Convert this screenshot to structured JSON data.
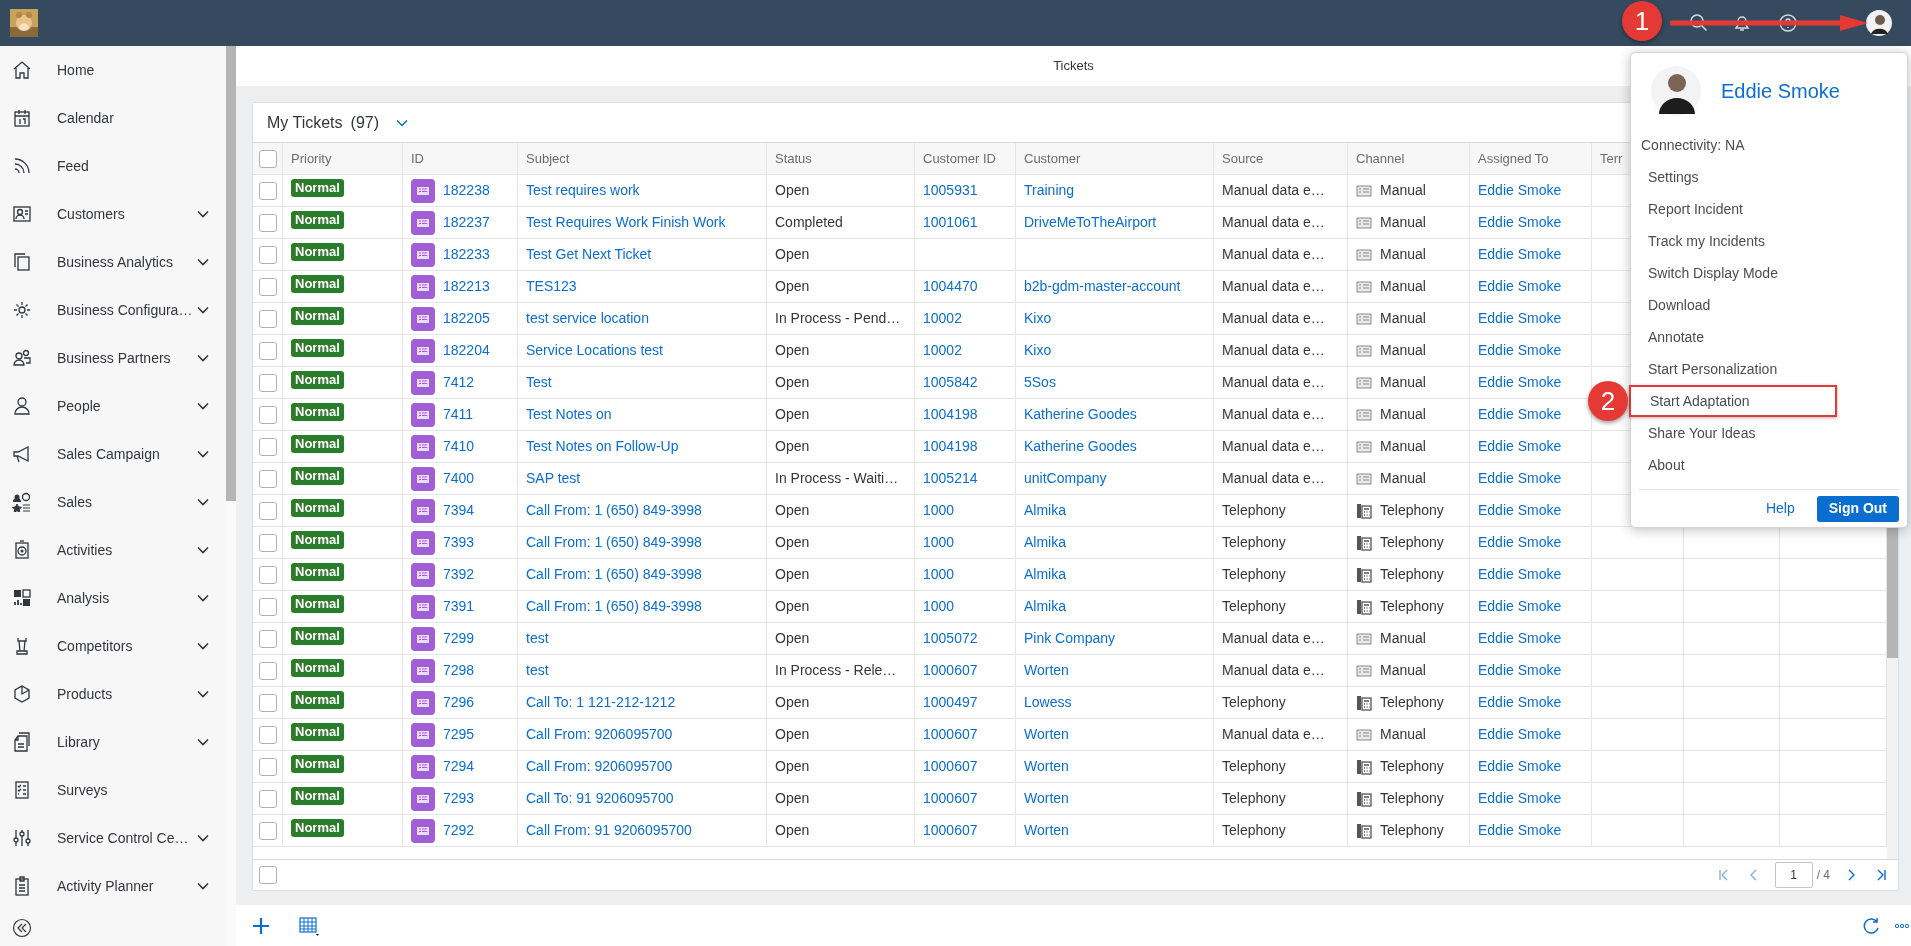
{
  "sidebar": {
    "items": [
      {
        "label": "Home",
        "expandable": false
      },
      {
        "label": "Calendar",
        "expandable": false
      },
      {
        "label": "Feed",
        "expandable": false
      },
      {
        "label": "Customers",
        "expandable": true
      },
      {
        "label": "Business Analytics",
        "expandable": true
      },
      {
        "label": "Business Configura…",
        "expandable": true
      },
      {
        "label": "Business Partners",
        "expandable": true
      },
      {
        "label": "People",
        "expandable": true
      },
      {
        "label": "Sales Campaign",
        "expandable": true
      },
      {
        "label": "Sales",
        "expandable": true
      },
      {
        "label": "Activities",
        "expandable": true
      },
      {
        "label": "Analysis",
        "expandable": true
      },
      {
        "label": "Competitors",
        "expandable": true
      },
      {
        "label": "Products",
        "expandable": true
      },
      {
        "label": "Library",
        "expandable": true
      },
      {
        "label": "Surveys",
        "expandable": false
      },
      {
        "label": "Service Control Ce…",
        "expandable": true
      },
      {
        "label": "Activity Planner",
        "expandable": true
      }
    ]
  },
  "page_title": "Tickets",
  "table": {
    "title": "My Tickets",
    "count": "(97)",
    "header_checked": false,
    "footer_checked": false,
    "columns": [
      "Priority",
      "ID",
      "Subject",
      "Status",
      "Customer ID",
      "Customer",
      "Source",
      "Channel",
      "Assigned To",
      "Terr"
    ],
    "rows": [
      {
        "selected": false,
        "priority": "Normal",
        "id": "182238",
        "subject": "Test requires work",
        "status": "Open",
        "customer_id": "1005931",
        "customer": "Training",
        "source": "Manual data e…",
        "channel": {
          "kind": "manual",
          "label": "Manual"
        },
        "assigned_to": "Eddie Smoke"
      },
      {
        "selected": false,
        "priority": "Normal",
        "id": "182237",
        "subject": "Test Requires Work Finish Work",
        "status": "Completed",
        "customer_id": "1001061",
        "customer": "DriveMeToTheAirport",
        "source": "Manual data e…",
        "channel": {
          "kind": "manual",
          "label": "Manual"
        },
        "assigned_to": "Eddie Smoke"
      },
      {
        "selected": false,
        "priority": "Normal",
        "id": "182233",
        "subject": "Test Get Next Ticket",
        "status": "Open",
        "source": "Manual data e…",
        "channel": {
          "kind": "manual",
          "label": "Manual"
        },
        "assigned_to": "Eddie Smoke"
      },
      {
        "selected": false,
        "priority": "Normal",
        "id": "182213",
        "subject": "TES123",
        "status": "Open",
        "customer_id": "1004470",
        "customer": "b2b-gdm-master-account",
        "source": "Manual data e…",
        "channel": {
          "kind": "manual",
          "label": "Manual"
        },
        "assigned_to": "Eddie Smoke"
      },
      {
        "selected": false,
        "priority": "Normal",
        "id": "182205",
        "subject": "test service location",
        "status": "In Process - Pend…",
        "customer_id": "10002",
        "customer": "Kixo",
        "source": "Manual data e…",
        "channel": {
          "kind": "manual",
          "label": "Manual"
        },
        "assigned_to": "Eddie Smoke"
      },
      {
        "selected": false,
        "priority": "Normal",
        "id": "182204",
        "subject": "Service Locations test",
        "status": "Open",
        "customer_id": "10002",
        "customer": "Kixo",
        "source": "Manual data e…",
        "channel": {
          "kind": "manual",
          "label": "Manual"
        },
        "assigned_to": "Eddie Smoke"
      },
      {
        "selected": false,
        "priority": "Normal",
        "id": "7412",
        "subject": "Test",
        "status": "Open",
        "customer_id": "1005842",
        "customer": "5Sos",
        "source": "Manual data e…",
        "channel": {
          "kind": "manual",
          "label": "Manual"
        },
        "assigned_to": "Eddie Smoke"
      },
      {
        "selected": false,
        "priority": "Normal",
        "id": "7411",
        "subject": "Test Notes on",
        "status": "Open",
        "customer_id": "1004198",
        "customer": "Katherine Goodes",
        "source": "Manual data e…",
        "channel": {
          "kind": "manual",
          "label": "Manual"
        },
        "assigned_to": "Eddie Smoke"
      },
      {
        "selected": false,
        "priority": "Normal",
        "id": "7410",
        "subject": "Test Notes on Follow-Up",
        "status": "Open",
        "customer_id": "1004198",
        "customer": "Katherine Goodes",
        "source": "Manual data e…",
        "channel": {
          "kind": "manual",
          "label": "Manual"
        },
        "assigned_to": "Eddie Smoke"
      },
      {
        "selected": false,
        "priority": "Normal",
        "id": "7400",
        "subject": "SAP test",
        "status": "In Process - Waiti…",
        "customer_id": "1005214",
        "customer": "unitCompany",
        "source": "Manual data e…",
        "channel": {
          "kind": "manual",
          "label": "Manual"
        },
        "assigned_to": "Eddie Smoke"
      },
      {
        "selected": false,
        "priority": "Normal",
        "id": "7394",
        "subject": "Call From: 1 (650) 849-3998",
        "status": "Open",
        "customer_id": "1000",
        "customer": "Almika",
        "source": "Telephony",
        "channel": {
          "kind": "telephony",
          "label": "Telephony"
        },
        "assigned_to": "Eddie Smoke"
      },
      {
        "selected": false,
        "priority": "Normal",
        "id": "7393",
        "subject": "Call From: 1 (650) 849-3998",
        "status": "Open",
        "customer_id": "1000",
        "customer": "Almika",
        "source": "Telephony",
        "channel": {
          "kind": "telephony",
          "label": "Telephony"
        },
        "assigned_to": "Eddie Smoke"
      },
      {
        "selected": false,
        "priority": "Normal",
        "id": "7392",
        "subject": "Call From: 1 (650) 849-3998",
        "status": "Open",
        "customer_id": "1000",
        "customer": "Almika",
        "source": "Telephony",
        "channel": {
          "kind": "telephony",
          "label": "Telephony"
        },
        "assigned_to": "Eddie Smoke"
      },
      {
        "selected": false,
        "priority": "Normal",
        "id": "7391",
        "subject": "Call From: 1 (650) 849-3998",
        "status": "Open",
        "customer_id": "1000",
        "customer": "Almika",
        "source": "Telephony",
        "channel": {
          "kind": "telephony",
          "label": "Telephony"
        },
        "assigned_to": "Eddie Smoke"
      },
      {
        "selected": false,
        "priority": "Normal",
        "id": "7299",
        "subject": "test",
        "status": "Open",
        "customer_id": "1005072",
        "customer": "Pink Company",
        "source": "Manual data e…",
        "channel": {
          "kind": "manual",
          "label": "Manual"
        },
        "assigned_to": "Eddie Smoke"
      },
      {
        "selected": false,
        "priority": "Normal",
        "id": "7298",
        "subject": "test",
        "status": "In Process - Rele…",
        "customer_id": "1000607",
        "customer": "Worten",
        "source": "Manual data e…",
        "channel": {
          "kind": "manual",
          "label": "Manual"
        },
        "assigned_to": "Eddie Smoke"
      },
      {
        "selected": false,
        "priority": "Normal",
        "id": "7296",
        "subject": "Call To: 1 121-212-1212",
        "status": "Open",
        "customer_id": "1000497",
        "customer": "Lowess",
        "source": "Telephony",
        "channel": {
          "kind": "telephony",
          "label": "Telephony"
        },
        "assigned_to": "Eddie Smoke"
      },
      {
        "selected": false,
        "priority": "Normal",
        "id": "7295",
        "subject": "Call From: 9206095700",
        "status": "Open",
        "customer_id": "1000607",
        "customer": "Worten",
        "source": "Manual data e…",
        "channel": {
          "kind": "manual",
          "label": "Manual"
        },
        "assigned_to": "Eddie Smoke"
      },
      {
        "selected": false,
        "priority": "Normal",
        "id": "7294",
        "subject": "Call From: 9206095700",
        "status": "Open",
        "customer_id": "1000607",
        "customer": "Worten",
        "source": "Telephony",
        "channel": {
          "kind": "telephony",
          "label": "Telephony"
        },
        "assigned_to": "Eddie Smoke"
      },
      {
        "selected": false,
        "priority": "Normal",
        "id": "7293",
        "subject": "Call To: 91 9206095700",
        "status": "Open",
        "customer_id": "1000607",
        "customer": "Worten",
        "source": "Telephony",
        "channel": {
          "kind": "telephony",
          "label": "Telephony"
        },
        "assigned_to": "Eddie Smoke"
      },
      {
        "selected": false,
        "priority": "Normal",
        "id": "7292",
        "subject": "Call From: 91 9206095700",
        "status": "Open",
        "customer_id": "1000607",
        "customer": "Worten",
        "source": "Telephony",
        "channel": {
          "kind": "telephony",
          "label": "Telephony"
        },
        "assigned_to": "Eddie Smoke"
      }
    ]
  },
  "pagination": {
    "page": "1",
    "total": "/ 4"
  },
  "user_menu": {
    "name": "Eddie Smoke",
    "connectivity": "Connectivity: NA",
    "items": [
      {
        "label": "Settings",
        "highlighted": false
      },
      {
        "label": "Report Incident",
        "highlighted": false
      },
      {
        "label": "Track my Incidents",
        "highlighted": false
      },
      {
        "label": "Switch Display Mode",
        "highlighted": false
      },
      {
        "label": "Download",
        "highlighted": false
      },
      {
        "label": "Annotate",
        "highlighted": false
      },
      {
        "label": "Start Personalization",
        "highlighted": false
      },
      {
        "label": "Start Adaptation",
        "highlighted": true
      },
      {
        "label": "Share Your Ideas",
        "highlighted": false
      },
      {
        "label": "About",
        "highlighted": false
      }
    ],
    "help": "Help",
    "sign_out": "Sign Out"
  },
  "annotations": [
    {
      "label": "1"
    },
    {
      "label": "2"
    }
  ]
}
